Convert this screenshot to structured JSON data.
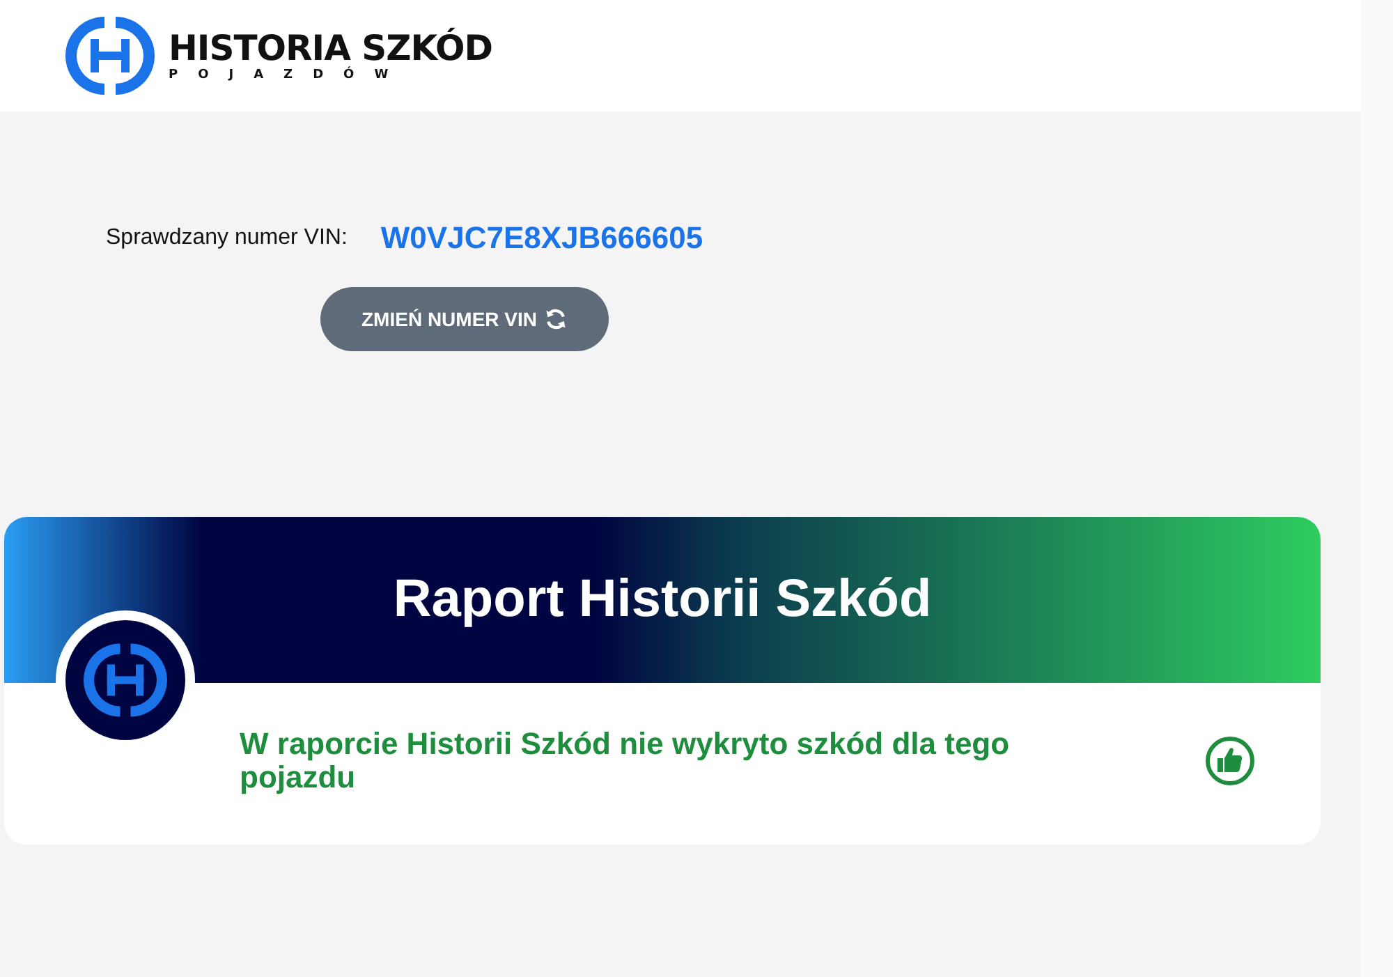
{
  "header": {
    "logo_title": "HISTORIA SZKÓD",
    "logo_subtitle": "POJAZDÓW"
  },
  "vin": {
    "label": "Sprawdzany numer VIN:",
    "value": "W0VJC7E8XJB666605"
  },
  "change_button": {
    "label": "ZMIEŃ NUMER VIN"
  },
  "report": {
    "title": "Raport Historii Szkód",
    "message": "W raporcie Historii Szkód nie wykryto szkód dla tego pojazdu"
  }
}
